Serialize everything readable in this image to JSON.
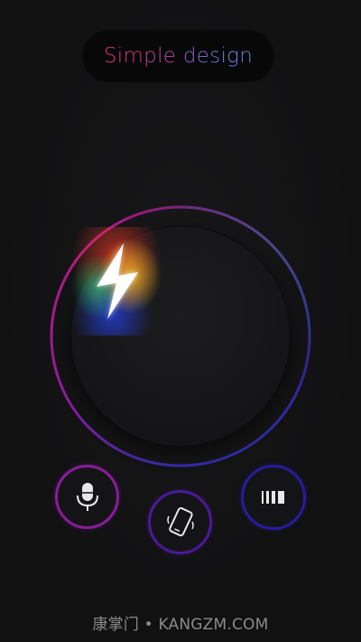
{
  "header": {
    "title": "Simple design"
  },
  "power_button": {
    "icon": "lightning-bolt-icon",
    "ring_gradient": [
      "#c2187a",
      "#8a1d9e",
      "#3a2aa8",
      "#4aa8c8"
    ]
  },
  "controls": [
    {
      "name": "microphone",
      "icon": "microphone-icon",
      "ring_color": "#8a1b9c"
    },
    {
      "name": "shake",
      "icon": "phone-shake-icon",
      "ring_color": "#4a1a9a"
    },
    {
      "name": "strobe",
      "icon": "strobe-bars-icon",
      "ring_color": "#2a1aa0"
    }
  ],
  "footer": {
    "watermark": "康掌门 • KANGZM.COM"
  }
}
